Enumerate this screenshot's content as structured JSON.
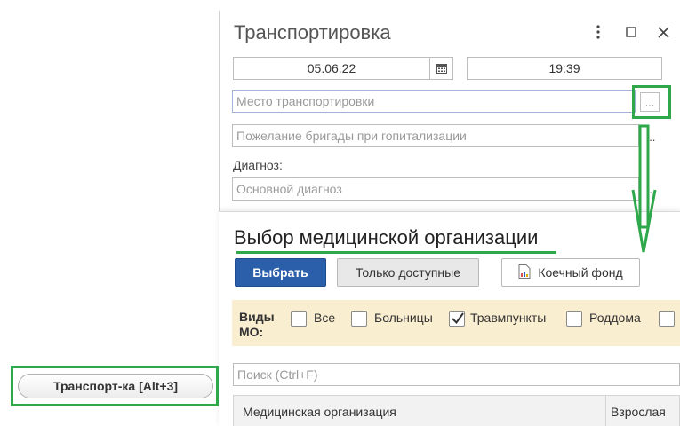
{
  "window": {
    "title": "Транспортировка",
    "date_value": "05.06.22",
    "time_value": "19:39",
    "place_placeholder": "Место транспортировки",
    "wish_placeholder": "Пожелание бригады при гопитализации",
    "diagnosis_label": "Диагноз:",
    "diagnosis_placeholder": "Основной диагноз",
    "select_button": "...",
    "menu_icon": "kebab-menu-icon",
    "maximize_icon": "maximize-icon",
    "close_icon": "close-icon"
  },
  "selection": {
    "title": "Выбор медицинской организации",
    "choose_button": "Выбрать",
    "available_toggle": "Только доступные",
    "bed_fund_button": "Коечный фонд",
    "filter_label": "Виды МО:",
    "filters": [
      {
        "label": "Все",
        "checked": false
      },
      {
        "label": "Больницы",
        "checked": false
      },
      {
        "label": "Травмпункты",
        "checked": true
      },
      {
        "label": "Роддома",
        "checked": false
      }
    ],
    "search_placeholder": "Поиск (Ctrl+F)",
    "columns": [
      "Медицинская организация",
      "Взрослая"
    ]
  },
  "taskbar": {
    "button_label": "Транспорт-ка [Alt+3]"
  },
  "colors": {
    "accent_green": "#2ea84a",
    "primary_blue": "#2b5faa",
    "filter_bg": "#faeed0"
  }
}
